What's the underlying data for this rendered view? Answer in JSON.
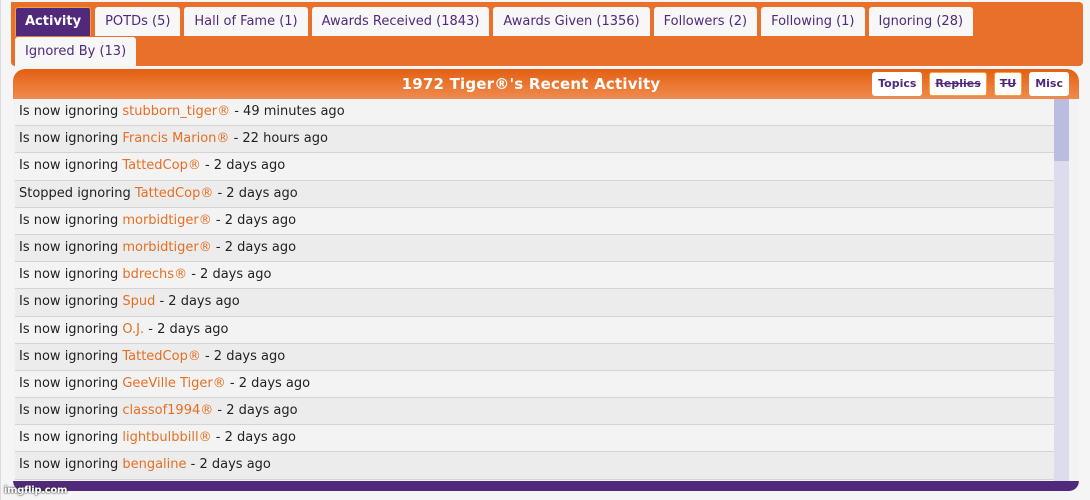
{
  "tabs": [
    {
      "label": "Activity",
      "active": true
    },
    {
      "label": "POTDs (5)",
      "active": false
    },
    {
      "label": "Hall of Fame (1)",
      "active": false
    },
    {
      "label": "Awards Received (1843)",
      "active": false
    },
    {
      "label": "Awards Given (1356)",
      "active": false
    },
    {
      "label": "Followers (2)",
      "active": false
    },
    {
      "label": "Following (1)",
      "active": false
    },
    {
      "label": "Ignoring (28)",
      "active": false
    },
    {
      "label": "Ignored By (13)",
      "active": false
    }
  ],
  "panel": {
    "title": "1972 Tiger®'s Recent Activity",
    "filters": [
      {
        "label": "Topics",
        "enabled": true
      },
      {
        "label": "Replies",
        "enabled": false
      },
      {
        "label": "TU",
        "enabled": false
      },
      {
        "label": "Misc",
        "enabled": true
      }
    ]
  },
  "activity": [
    {
      "action": "Is now ignoring",
      "user": "stubborn_tiger®",
      "time": "- 49 minutes ago"
    },
    {
      "action": "Is now ignoring",
      "user": "Francis Marion®",
      "time": "- 22 hours ago"
    },
    {
      "action": "Is now ignoring",
      "user": "TattedCop®",
      "time": "- 2 days ago"
    },
    {
      "action": "Stopped ignoring",
      "user": "TattedCop®",
      "time": "- 2 days ago"
    },
    {
      "action": "Is now ignoring",
      "user": "morbidtiger®",
      "time": "- 2 days ago"
    },
    {
      "action": "Is now ignoring",
      "user": "morbidtiger®",
      "time": "- 2 days ago"
    },
    {
      "action": "Is now ignoring",
      "user": "bdrechs®",
      "time": "- 2 days ago"
    },
    {
      "action": "Is now ignoring",
      "user": "Spud",
      "time": "- 2 days ago"
    },
    {
      "action": "Is now ignoring",
      "user": "O.J.",
      "time": "- 2 days ago"
    },
    {
      "action": "Is now ignoring",
      "user": "TattedCop®",
      "time": "- 2 days ago"
    },
    {
      "action": "Is now ignoring",
      "user": "GeeVille Tiger®",
      "time": "- 2 days ago"
    },
    {
      "action": "Is now ignoring",
      "user": "classof1994®",
      "time": "- 2 days ago"
    },
    {
      "action": "Is now ignoring",
      "user": "lightbulbbill®",
      "time": "- 2 days ago"
    },
    {
      "action": "Is now ignoring",
      "user": "bengaline",
      "time": "- 2 days ago"
    }
  ],
  "watermark": "imgflip.com",
  "colors": {
    "accent_orange": "#E8702A",
    "accent_purple": "#51297A",
    "link_orange": "#E66F23"
  }
}
